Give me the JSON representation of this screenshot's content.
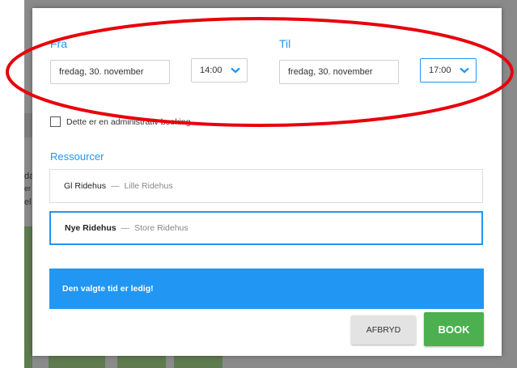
{
  "colors": {
    "accent": "#2196f3",
    "book": "#4caf50",
    "annotation": "#e8000b"
  },
  "background": {
    "fragments": [
      "da",
      "er",
      "el"
    ]
  },
  "dialog": {
    "from_label": "Fra",
    "to_label": "Til",
    "from_date": "fredag, 30. november",
    "from_time": "14:00",
    "to_date": "fredag, 30. november",
    "to_time": "17:00",
    "admin_booking_label": "Dette er en administrativ booking",
    "resources_title": "Ressourcer",
    "resources": [
      {
        "name": "Gl Ridehus",
        "sub": "Lille Ridehus",
        "selected": false
      },
      {
        "name": "Nye Ridehus",
        "sub": "Store Ridehus",
        "selected": true
      }
    ],
    "status_message": "Den valgte tid er ledig!",
    "cancel_label": "AFBRYD",
    "book_label": "BOOK"
  },
  "icons": {
    "time_dropdown": "chevron-down-icon"
  }
}
